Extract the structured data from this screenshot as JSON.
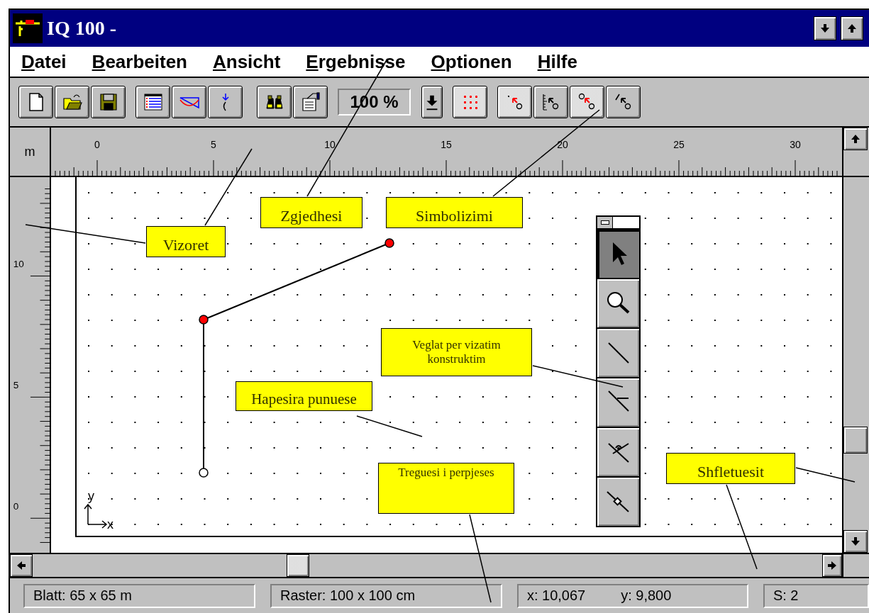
{
  "window": {
    "title": "IQ 100 -"
  },
  "menu": [
    "Datei",
    "Bearbeiten",
    "Ansicht",
    "Ergebnisse",
    "Optionen",
    "Hilfe"
  ],
  "toolbar": {
    "zoom": "100 %",
    "toggles": [
      {
        "on": true
      },
      {
        "on": true
      },
      {
        "on": false
      },
      {
        "on": true
      },
      {
        "on": false
      }
    ]
  },
  "rulers": {
    "unit": "m",
    "horizontal": [
      "0",
      "5",
      "10",
      "15",
      "20",
      "25",
      "30"
    ],
    "vertical": [
      "10",
      "5",
      "0"
    ]
  },
  "canvas": {
    "axes": {
      "y": "y",
      "x": "x"
    },
    "nodes": [
      {
        "color": "#ff0000"
      },
      {
        "color": "#ff0000"
      },
      {
        "color": "#ffffff"
      }
    ]
  },
  "tool_palette": {
    "tools": [
      {
        "selected": true
      },
      {
        "selected": false
      },
      {
        "selected": false
      },
      {
        "selected": false
      },
      {
        "selected": false
      },
      {
        "selected": false
      }
    ]
  },
  "callouts": [
    {
      "text": "Vizoret"
    },
    {
      "text": "Zgjedhesi"
    },
    {
      "text": "Simbolizimi"
    },
    {
      "text": "Veglat per vizatim konstruktim"
    },
    {
      "text": "Hapesira punuese"
    },
    {
      "text": "Treguesi i perpjeses"
    },
    {
      "text": "Shfletuesit"
    }
  ],
  "status_bar": {
    "sheet": "Blatt: 65 x 65 m",
    "grid": "Raster: 100 x 100 cm",
    "x": "x: 10,067",
    "y": "y: 9,800",
    "s": "S: 2"
  }
}
